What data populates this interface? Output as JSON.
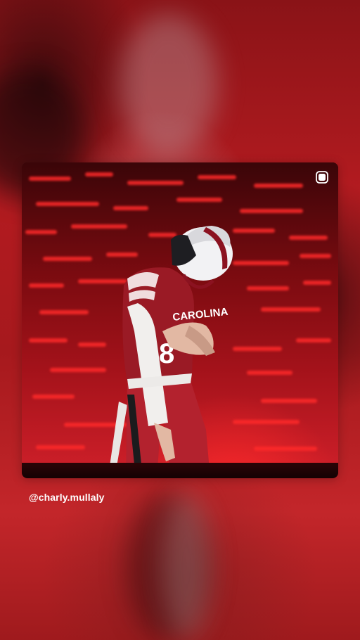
{
  "story": {
    "attribution_handle": "@charly.mullaly",
    "post_icon": "instagram-post-icon",
    "jersey_text": "CAROLINA",
    "jersey_number": "8"
  },
  "colors": {
    "background": "#a6191d",
    "handle_text": "#ffffff"
  }
}
